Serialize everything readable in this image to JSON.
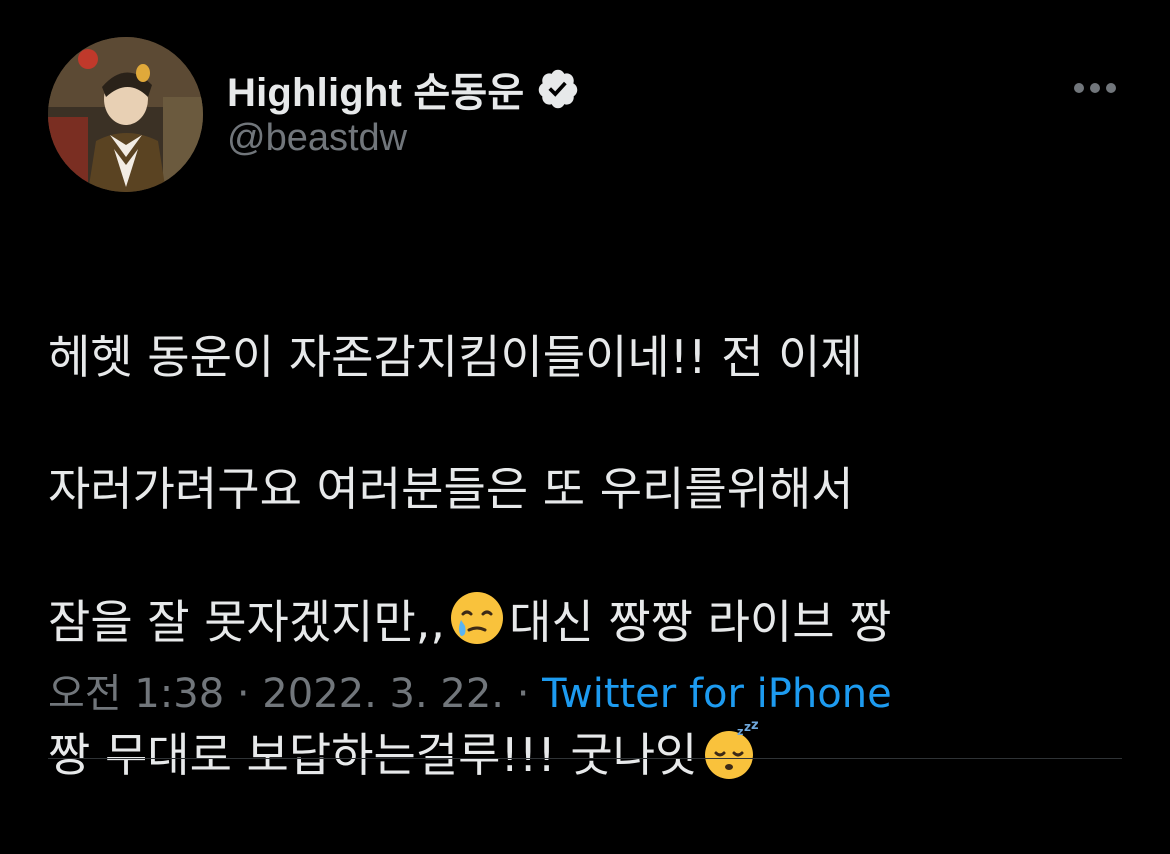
{
  "author": {
    "display_name": "Highlight 손동운",
    "handle": "@beastdw",
    "verified": true,
    "avatar_icon": "profile-photo"
  },
  "tweet": {
    "lines": [
      "헤헷 동운이 자존감지킴이들이네!! 전 이제",
      "자러가려구요 여러분들은 또 우리를위해서",
      "잠을 잘 못자겠지만,,",
      "대신 짱짱 라이브 짱",
      "짱 무대로 보답하는걸루!!! 굿나잇"
    ],
    "emojis": [
      "face-holding-back-tears",
      "sleeping-face"
    ]
  },
  "meta": {
    "time": "오전 1:38",
    "separator": " · ",
    "date": "2022. 3. 22.",
    "source": "Twitter for iPhone"
  },
  "colors": {
    "background": "#000000",
    "text_primary": "#e7e9ea",
    "text_secondary": "#71767b",
    "link": "#1d9bf0",
    "divider": "#2f3336"
  },
  "icons": {
    "verified": "verified-badge-icon",
    "more": "more-options-icon"
  }
}
